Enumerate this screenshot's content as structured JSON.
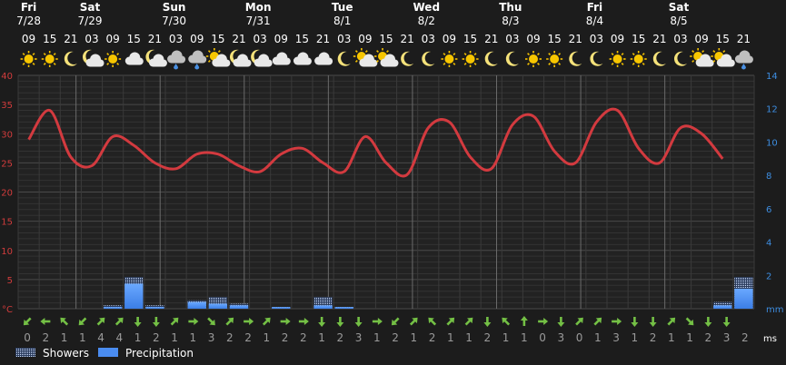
{
  "chart_data": {
    "type": "line",
    "days": [
      {
        "dow": "Fri",
        "date": "7/28"
      },
      {
        "dow": "Sat",
        "date": "7/29"
      },
      {
        "dow": "Sun",
        "date": "7/30"
      },
      {
        "dow": "Mon",
        "date": "7/31"
      },
      {
        "dow": "Tue",
        "date": "8/1"
      },
      {
        "dow": "Wed",
        "date": "8/2"
      },
      {
        "dow": "Thu",
        "date": "8/3"
      },
      {
        "dow": "Fri",
        "date": "8/4"
      },
      {
        "dow": "Sat",
        "date": "8/5"
      }
    ],
    "hours": [
      "09",
      "15",
      "21",
      "03",
      "09",
      "15",
      "21",
      "03",
      "09",
      "15",
      "21",
      "03",
      "09",
      "15",
      "21",
      "03",
      "09",
      "15",
      "21",
      "03",
      "09",
      "15",
      "21",
      "03",
      "09",
      "15",
      "21",
      "03",
      "09",
      "15",
      "21",
      "03",
      "09",
      "15",
      "21"
    ],
    "icons": [
      "sun",
      "sun",
      "moon",
      "moon-cloud",
      "sun",
      "cloud",
      "moon-cloud",
      "rain",
      "rain",
      "sun-cloud",
      "moon-cloud",
      "moon-cloud",
      "cloud",
      "cloud",
      "cloud",
      "moon",
      "sun-cloud",
      "sun-cloud",
      "moon",
      "moon",
      "sun",
      "sun",
      "moon",
      "moon",
      "sun",
      "sun",
      "moon",
      "moon",
      "sun",
      "sun",
      "moon",
      "moon",
      "sun-cloud",
      "sun-cloud",
      "rain"
    ],
    "temperature": [
      29,
      34,
      26,
      24.5,
      29.5,
      28,
      25,
      24,
      26.5,
      26.5,
      24.5,
      23.5,
      26.5,
      27.5,
      25,
      23.5,
      29.5,
      25,
      23,
      31,
      32,
      26,
      24,
      31.5,
      33,
      27,
      25,
      32,
      34,
      27.5,
      25,
      31,
      30,
      25.7
    ],
    "showers": [
      0,
      0,
      0,
      0,
      0.2,
      1.9,
      0.2,
      0,
      0.5,
      0.7,
      0.3,
      0,
      0.1,
      0,
      0.7,
      0.1,
      0,
      0,
      0,
      0,
      0,
      0,
      0,
      0,
      0,
      0,
      0,
      0,
      0,
      0,
      0,
      0,
      0,
      0.4,
      1.9
    ],
    "precipitation": [
      0,
      0,
      0,
      0,
      0.1,
      1.5,
      0.1,
      0,
      0.4,
      0.3,
      0.2,
      0,
      0.1,
      0,
      0.2,
      0.1,
      0,
      0,
      0,
      0,
      0,
      0,
      0,
      0,
      0,
      0,
      0,
      0,
      0,
      0,
      0,
      0,
      0,
      0.2,
      1.2
    ],
    "wind_speed": [
      0,
      2,
      1,
      1,
      4,
      4,
      1,
      2,
      1,
      1,
      3,
      2,
      2,
      1,
      2,
      2,
      1,
      2,
      3,
      1,
      2,
      1,
      2,
      1,
      1,
      2,
      1,
      1,
      0,
      3,
      0,
      1,
      3,
      1,
      2,
      1,
      1,
      2,
      3,
      2
    ],
    "wind_arrows": [
      "sw",
      "w",
      "nw",
      "sw",
      "ne",
      "ne",
      "s",
      "s",
      "ne",
      "e",
      "se",
      "ne",
      "e",
      "ne",
      "e",
      "e",
      "s",
      "s",
      "s",
      "e",
      "sw",
      "ne",
      "nw",
      "ne",
      "ne",
      "s",
      "nw",
      "n",
      "e",
      "s",
      "ne",
      "ne",
      "e",
      "s",
      "s",
      "ne",
      "se",
      "s",
      "s"
    ],
    "ylim_left": [
      0,
      40
    ],
    "ylim_right": [
      0,
      14
    ],
    "y_ticks_left": [
      "40",
      "35",
      "30",
      "25",
      "20",
      "15",
      "10",
      "5",
      "°C"
    ],
    "y_ticks_right": [
      "14",
      "12",
      "10",
      "8",
      "6",
      "4",
      "2",
      "mm"
    ],
    "wind_unit": "ms",
    "colors": {
      "temperature": "#d33a3f",
      "precipitation": "#4a8cf0",
      "axis_left": "#d23c3c",
      "axis_right": "#3d8de0",
      "wind": "#74c045"
    },
    "legend": [
      {
        "key": "showers",
        "label": "Showers"
      },
      {
        "key": "precipitation",
        "label": "Precipitation"
      }
    ]
  }
}
